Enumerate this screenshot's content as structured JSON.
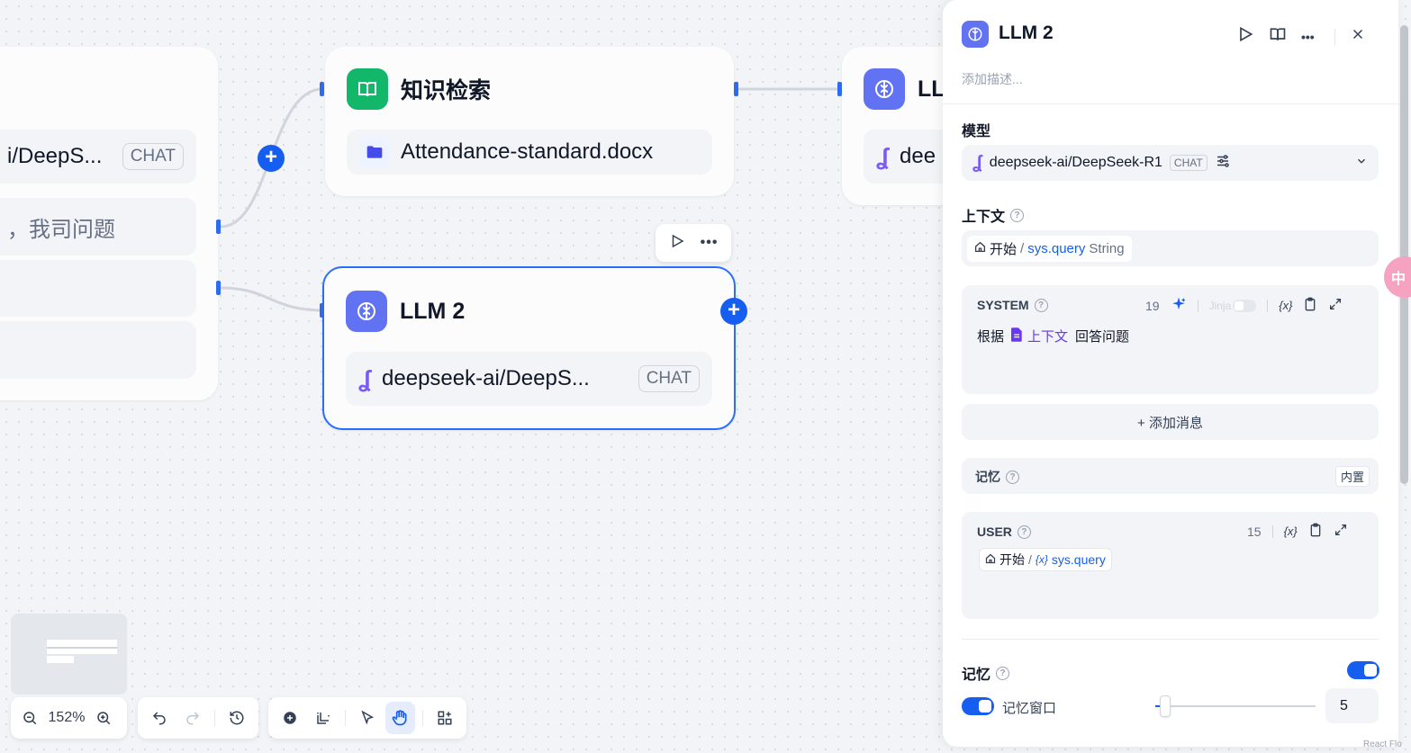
{
  "canvas": {
    "start_node": {
      "model_row": "i/DeepS...",
      "chat_badge": "CHAT",
      "query_row": "，我司问题"
    },
    "kb_node": {
      "title": "知识检索",
      "file": "Attendance-standard.docx"
    },
    "llm1_node": {
      "title": "LL",
      "model": "dee"
    },
    "llm2_node": {
      "title": "LLM 2",
      "model": "deepseek-ai/DeepS...",
      "chat_badge": "CHAT"
    },
    "plus_symbol": "+",
    "more_symbol": "•••"
  },
  "toolbar": {
    "zoom_value": "152%"
  },
  "panel": {
    "title": "LLM 2",
    "description_placeholder": "添加描述...",
    "model": {
      "label": "模型",
      "name": "deepseek-ai/DeepSeek-R1",
      "badge": "CHAT"
    },
    "context": {
      "label": "上下文",
      "source_node": "开始",
      "separator": "/",
      "variable": "sys.query",
      "type": "String"
    },
    "system": {
      "label": "SYSTEM",
      "count": "19",
      "jinja_label": "Jinja",
      "var_label": "{x}",
      "text_before": "根据",
      "context_var": "上下文",
      "text_after": "回答问题"
    },
    "add_message": "+ 添加消息",
    "memory_box": {
      "label": "记忆",
      "badge": "内置"
    },
    "user": {
      "label": "USER",
      "count": "15",
      "var_label": "{x}",
      "source_node": "开始",
      "separator": "/",
      "var_icon": "{x}",
      "variable": "sys.query"
    },
    "memory": {
      "label": "记忆",
      "enabled": true,
      "window_label": "记忆窗口",
      "window_enabled": true,
      "window_value": "5"
    }
  },
  "overflow": {
    "badge_char": "中",
    "bottom_right": "React Flo"
  },
  "colors": {
    "accent": "#155eef",
    "kb_green": "#12b76a",
    "llm_indigo": "#6172f3",
    "model_purple": "#7a5af8"
  }
}
